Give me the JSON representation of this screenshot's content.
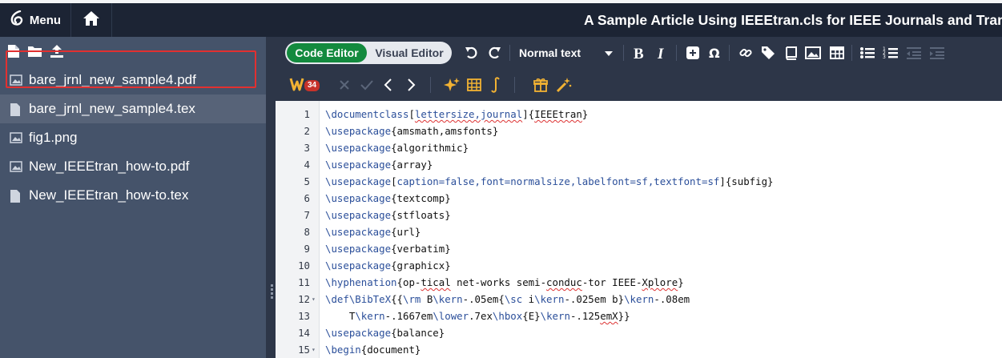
{
  "topbar": {
    "menu_label": "Menu",
    "title": "A Sample Article Using IEEEtran.cls for IEEE Journals and Transactic"
  },
  "sidebar": {
    "files": [
      {
        "name": "bare_jrnl_new_sample4.pdf",
        "icon": "image-icon"
      },
      {
        "name": "bare_jrnl_new_sample4.tex",
        "icon": "file-icon",
        "active": true
      },
      {
        "name": "fig1.png",
        "icon": "image-icon"
      },
      {
        "name": "New_IEEEtran_how-to.pdf",
        "icon": "image-icon"
      },
      {
        "name": "New_IEEEtran_how-to.tex",
        "icon": "file-icon"
      }
    ]
  },
  "toolbar": {
    "code_editor_label": "Code Editor",
    "visual_editor_label": "Visual Editor",
    "style_select": "Normal text",
    "badge_count": "34"
  },
  "editor": {
    "lines": [
      {
        "n": "1",
        "fold": false,
        "tokens": [
          {
            "t": "\\documentclass",
            "c": "kw"
          },
          {
            "t": "["
          },
          {
            "t": "lettersize,journal",
            "c": "kw",
            "sq": true
          },
          {
            "t": "]{"
          },
          {
            "t": "IEEEtran",
            "sq": true
          },
          {
            "t": "}"
          }
        ]
      },
      {
        "n": "2",
        "fold": false,
        "tokens": [
          {
            "t": "\\usepackage",
            "c": "kw"
          },
          {
            "t": "{amsmath,amsfonts}"
          }
        ]
      },
      {
        "n": "3",
        "fold": false,
        "tokens": [
          {
            "t": "\\usepackage",
            "c": "kw"
          },
          {
            "t": "{algorithmic}"
          }
        ]
      },
      {
        "n": "4",
        "fold": false,
        "tokens": [
          {
            "t": "\\usepackage",
            "c": "kw"
          },
          {
            "t": "{array}"
          }
        ]
      },
      {
        "n": "5",
        "fold": false,
        "tokens": [
          {
            "t": "\\usepackage",
            "c": "kw"
          },
          {
            "t": "["
          },
          {
            "t": "caption=false,font=normalsize,labelfont=sf,textfont=sf",
            "c": "kw"
          },
          {
            "t": "]{subfig}"
          }
        ]
      },
      {
        "n": "6",
        "fold": false,
        "tokens": [
          {
            "t": "\\usepackage",
            "c": "kw"
          },
          {
            "t": "{textcomp}"
          }
        ]
      },
      {
        "n": "7",
        "fold": false,
        "tokens": [
          {
            "t": "\\usepackage",
            "c": "kw"
          },
          {
            "t": "{stfloats}"
          }
        ]
      },
      {
        "n": "8",
        "fold": false,
        "tokens": [
          {
            "t": "\\usepackage",
            "c": "kw"
          },
          {
            "t": "{url}"
          }
        ]
      },
      {
        "n": "9",
        "fold": false,
        "tokens": [
          {
            "t": "\\usepackage",
            "c": "kw"
          },
          {
            "t": "{verbatim}"
          }
        ]
      },
      {
        "n": "10",
        "fold": false,
        "tokens": [
          {
            "t": "\\usepackage",
            "c": "kw"
          },
          {
            "t": "{graphicx}"
          }
        ]
      },
      {
        "n": "11",
        "fold": false,
        "tokens": [
          {
            "t": "\\hyphenation",
            "c": "kw"
          },
          {
            "t": "{op-"
          },
          {
            "t": "tical",
            "sq": true
          },
          {
            "t": " net-works semi-"
          },
          {
            "t": "conduc",
            "sq": true
          },
          {
            "t": "-tor IEEE-"
          },
          {
            "t": "Xplore",
            "sq": true
          },
          {
            "t": "}"
          }
        ]
      },
      {
        "n": "12",
        "fold": true,
        "tokens": [
          {
            "t": "\\def",
            "c": "kw"
          },
          {
            "t": "\\BibTeX",
            "c": "kw"
          },
          {
            "t": "{{"
          },
          {
            "t": "\\rm",
            "c": "kw"
          },
          {
            "t": " B"
          },
          {
            "t": "\\kern",
            "c": "kw"
          },
          {
            "t": "-.05em{"
          },
          {
            "t": "\\sc",
            "c": "kw"
          },
          {
            "t": " i"
          },
          {
            "t": "\\kern",
            "c": "kw"
          },
          {
            "t": "-.025em b}"
          },
          {
            "t": "\\kern",
            "c": "kw"
          },
          {
            "t": "-.08em"
          }
        ]
      },
      {
        "n": "13",
        "fold": false,
        "tokens": [
          {
            "t": "    T"
          },
          {
            "t": "\\kern",
            "c": "kw"
          },
          {
            "t": "-.1667em"
          },
          {
            "t": "\\lower",
            "c": "kw"
          },
          {
            "t": ".7ex"
          },
          {
            "t": "\\hbox",
            "c": "kw"
          },
          {
            "t": "{E}"
          },
          {
            "t": "\\kern",
            "c": "kw"
          },
          {
            "t": "-.125"
          },
          {
            "t": "emX",
            "sq": true
          },
          {
            "t": "}}"
          }
        ]
      },
      {
        "n": "14",
        "fold": false,
        "tokens": [
          {
            "t": "\\usepackage",
            "c": "kw"
          },
          {
            "t": "{balance}"
          }
        ]
      },
      {
        "n": "15",
        "fold": true,
        "tokens": [
          {
            "t": "\\begin",
            "c": "kw"
          },
          {
            "t": "{document}"
          }
        ]
      }
    ]
  },
  "colors": {
    "topbar_bg": "#1c2434",
    "sidebar_bg": "#45536a",
    "toolbar_bg": "#2d3648",
    "accent_green": "#138a3e",
    "highlight_red": "#e23030",
    "keyword_blue": "#2b4f9a"
  }
}
